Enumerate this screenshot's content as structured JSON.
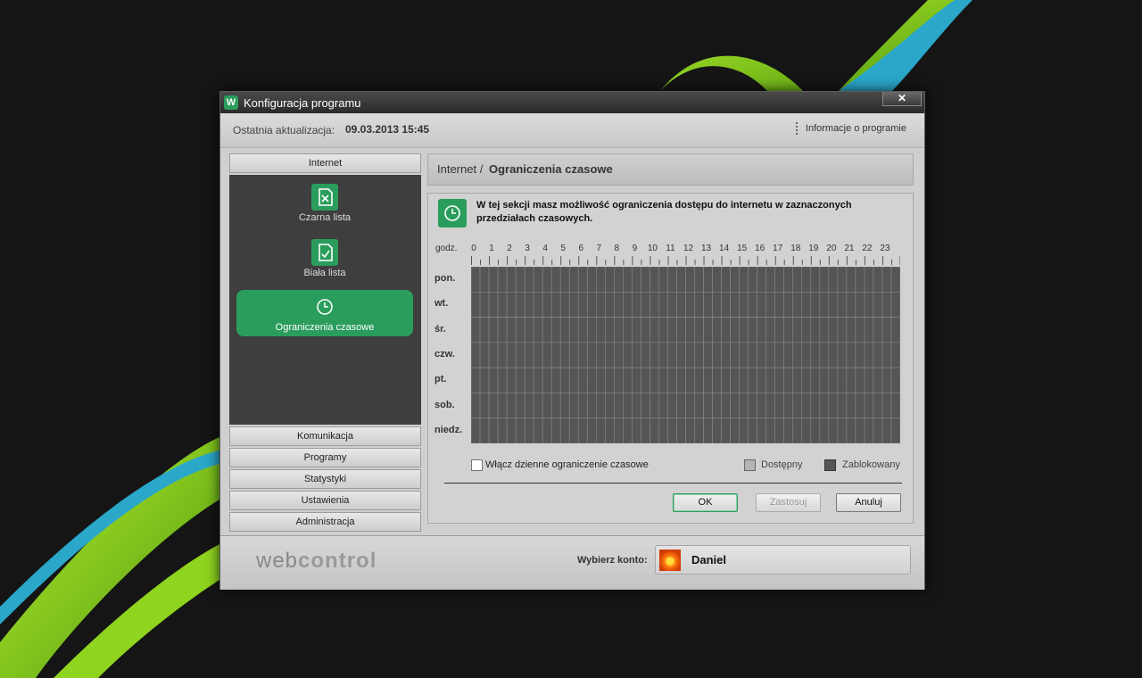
{
  "window": {
    "title": "Konfiguracja programu",
    "app_icon": "W",
    "close_label": "✕"
  },
  "infobar": {
    "last_update_label": "Ostatnia aktualizacja:",
    "last_update_value": "09.03.2013 15:45",
    "about_label": "Informacje o programie"
  },
  "sidebar": {
    "categories": [
      "Internet",
      "Komunikacja",
      "Programy",
      "Statystyki",
      "Ustawienia",
      "Administracja"
    ],
    "internet_items": [
      {
        "label": "Czarna lista",
        "icon": "blacklist-icon"
      },
      {
        "label": "Biała lista",
        "icon": "whitelist-icon"
      },
      {
        "label": "Ograniczenia czasowe",
        "icon": "clock-icon"
      }
    ]
  },
  "breadcrumb": {
    "parent": "Internet /",
    "current": "Ograniczenia czasowe"
  },
  "info": {
    "text": "W tej sekcji masz możliwość ograniczenia dostępu do internetu w zaznaczonych przedziałach czasowych."
  },
  "schedule": {
    "hours_label": "godz.",
    "hours": [
      "0",
      "1",
      "2",
      "3",
      "4",
      "5",
      "6",
      "7",
      "8",
      "9",
      "10",
      "11",
      "12",
      "13",
      "14",
      "15",
      "16",
      "17",
      "18",
      "19",
      "20",
      "21",
      "22",
      "23"
    ],
    "days": [
      "pon.",
      "wt.",
      "śr.",
      "czw.",
      "pt.",
      "sob.",
      "niedz."
    ],
    "cells_per_hour": 2,
    "all_blocked": true
  },
  "options": {
    "daily_limit_label": "Włącz dzienne ograniczenie czasowe",
    "daily_limit_checked": false
  },
  "legend": {
    "available": "Dostępny",
    "blocked": "Zablokowany"
  },
  "buttons": {
    "ok": "OK",
    "apply": "Zastosuj",
    "cancel": "Anuluj"
  },
  "footer": {
    "brand_part1": "web",
    "brand_part2": "control",
    "account_label": "Wybierz konto:",
    "account_name": "Daniel"
  },
  "colors": {
    "accent": "#2a9d5c",
    "blocked": "#555555",
    "available": "#b4b4b4",
    "swoosh_green": "#7ec41e",
    "swoosh_blue": "#2aa7c9"
  }
}
